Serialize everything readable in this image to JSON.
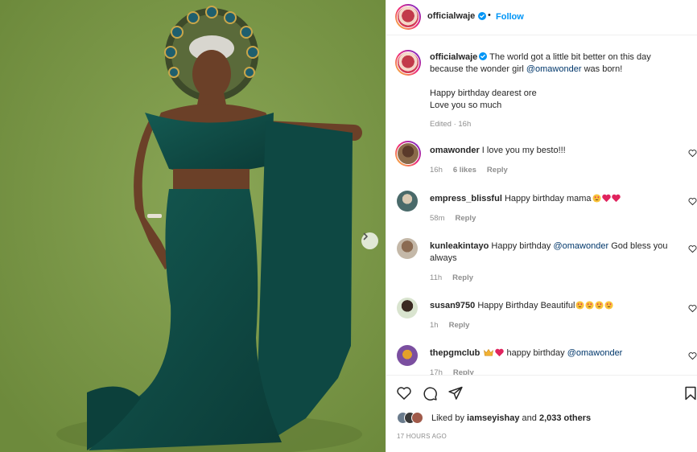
{
  "post": {
    "username": "officialwaje",
    "follow_label": "Follow",
    "dot": "•"
  },
  "caption": {
    "username": "officialwaje",
    "line1": "The world got a little bit better on this day because the wonder girl",
    "mention": "@omawonder",
    "line1_end": "was born!",
    "line2": "Happy birthday dearest ore",
    "line3": "Love you so much",
    "edited": "Edited · 16h"
  },
  "comments": [
    {
      "username": "omawonder",
      "text": "I love you my besto!!!",
      "time": "16h",
      "likes": "6 likes",
      "reply": "Reply"
    },
    {
      "username": "empress_blissful",
      "text": "Happy birthday mama",
      "emojis": [
        "heart-eyes-emoji",
        "red-heart-emoji",
        "red-heart-emoji"
      ],
      "time": "58m",
      "reply": "Reply"
    },
    {
      "username": "kunleakintayo",
      "text": "Happy birthday",
      "mention": "@omawonder",
      "text_end": "God bless you always",
      "time": "11h",
      "reply": "Reply"
    },
    {
      "username": "susan9750",
      "text": "Happy Birthday Beautiful",
      "emojis": [
        "heart-eyes-emoji",
        "heart-eyes-emoji",
        "heart-eyes-emoji",
        "heart-eyes-emoji"
      ],
      "time": "1h",
      "reply": "Reply"
    },
    {
      "username": "thepgmclub",
      "emojis": [
        "crown-emoji",
        "red-heart-emoji"
      ],
      "text": "happy birthday",
      "mention": "@omawonder",
      "time": "17h",
      "reply": "Reply"
    }
  ],
  "likes": {
    "prefix": "Liked by",
    "user": "iamseyishay",
    "middle": "and",
    "count": "2,033 others"
  },
  "timestamp": "17 HOURS AGO",
  "icons": {
    "like": "heart-outline-icon",
    "comment": "speech-bubble-icon",
    "share": "paper-plane-icon",
    "save": "bookmark-icon",
    "next": "chevron-right-icon",
    "verified": "verified-badge-icon"
  },
  "colors": {
    "accent": "#0095f6",
    "mention": "#00376b",
    "muted": "#8e8e8e",
    "background_green": "#7c9849",
    "dress_green": "#0f4a45"
  }
}
